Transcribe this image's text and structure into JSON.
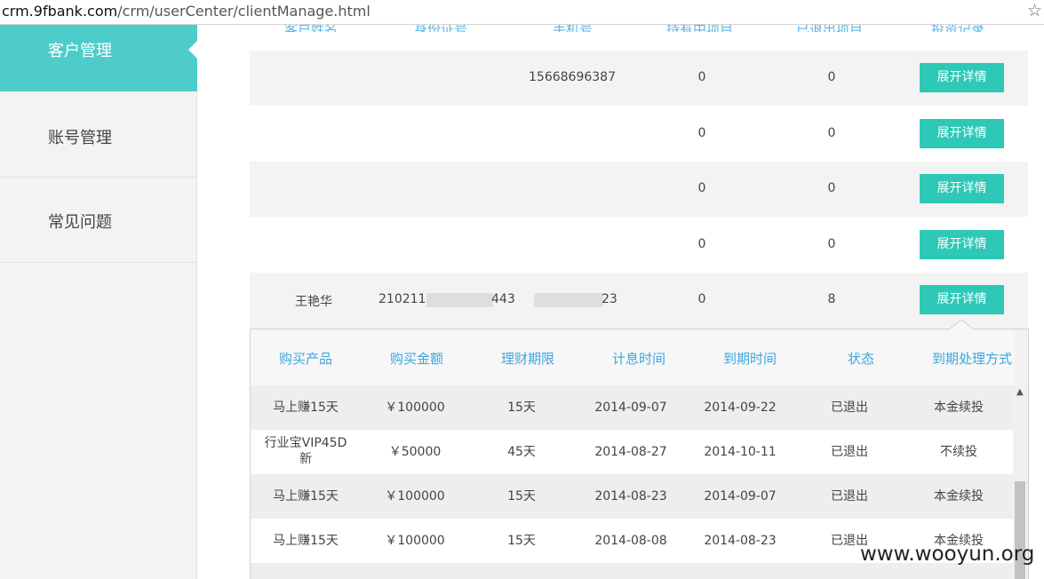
{
  "browser": {
    "url_host": "crm.9fbank.com",
    "url_path": "/crm/userCenter/clientManage.html",
    "star": "☆"
  },
  "sidebar": {
    "items": [
      {
        "label": "客户管理"
      },
      {
        "label": "账号管理"
      },
      {
        "label": "常见问题"
      }
    ]
  },
  "table": {
    "header_cut": [
      "客户姓名",
      "身份证号",
      "手机号",
      "持有中项目",
      "已退出项目",
      "投资记录"
    ],
    "rows": [
      {
        "name": "",
        "id_card": "",
        "phone": "15668696387",
        "holding": "0",
        "exited": "0",
        "button": "展开详情"
      },
      {
        "name": "",
        "id_card": "",
        "phone": "",
        "holding": "0",
        "exited": "0",
        "button": "展开详情"
      },
      {
        "name": "",
        "id_card": "",
        "phone": "",
        "holding": "0",
        "exited": "0",
        "button": "展开详情"
      },
      {
        "name": "",
        "id_card": "",
        "phone": "",
        "holding": "0",
        "exited": "0",
        "button": "展开详情"
      },
      {
        "name": "王艳华",
        "id_card_prefix": "2102111",
        "id_card_suffix": "443",
        "phone_suffix": "23",
        "holding": "0",
        "exited": "8",
        "button": "展开详情"
      }
    ]
  },
  "detail": {
    "headers": [
      "购买产品",
      "购买金额",
      "理财期限",
      "计息时间",
      "到期时间",
      "状态",
      "到期处理方式"
    ],
    "rows": [
      {
        "product": "马上赚15天",
        "amount": "￥100000",
        "term": "15天",
        "start": "2014-09-07",
        "end": "2014-09-22",
        "status": "已退出",
        "method": "本金续投"
      },
      {
        "product_l1": "行业宝VIP45D",
        "product_l2": "新",
        "amount": "￥50000",
        "term": "45天",
        "start": "2014-08-27",
        "end": "2014-10-11",
        "status": "已退出",
        "method": "不续投"
      },
      {
        "product": "马上赚15天",
        "amount": "￥100000",
        "term": "15天",
        "start": "2014-08-23",
        "end": "2014-09-07",
        "status": "已退出",
        "method": "本金续投"
      },
      {
        "product": "马上赚15天",
        "amount": "￥100000",
        "term": "15天",
        "start": "2014-08-08",
        "end": "2014-08-23",
        "status": "已退出",
        "method": "本金续投"
      }
    ]
  },
  "watermark": "www.wooyun.org"
}
